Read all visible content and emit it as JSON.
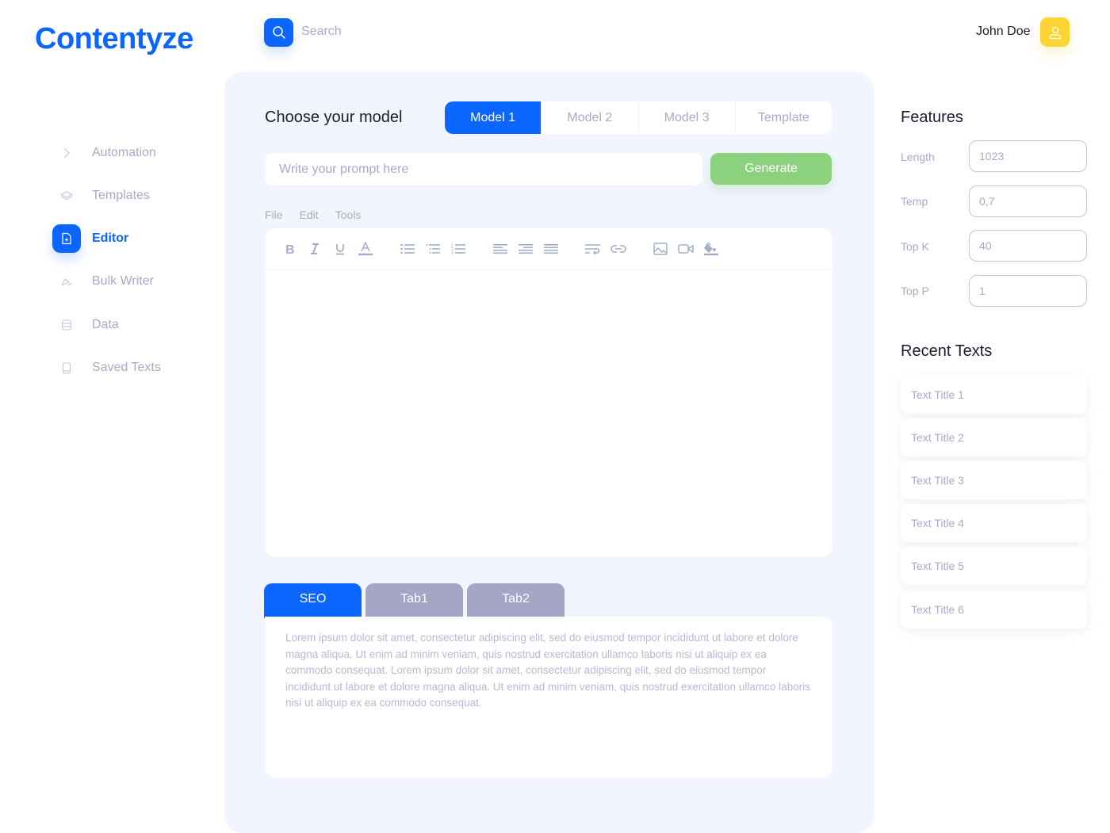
{
  "app": {
    "logo": "Contentyze",
    "brand_color": "#0a66ff"
  },
  "header": {
    "search_label": "Search",
    "user_name": "John Doe"
  },
  "sidebar": {
    "items": [
      {
        "label": "Automation",
        "icon": "chevron-right-icon",
        "active": false
      },
      {
        "label": "Templates",
        "icon": "layers-icon",
        "active": false
      },
      {
        "label": "Editor",
        "icon": "document-icon",
        "active": true
      },
      {
        "label": "Bulk Writer",
        "icon": "pen-icon",
        "active": false
      },
      {
        "label": "Data",
        "icon": "database-icon",
        "active": false
      },
      {
        "label": "Saved Texts",
        "icon": "book-icon",
        "active": false
      }
    ]
  },
  "main": {
    "choose_title": "Choose your model",
    "model_tabs": [
      {
        "label": "Model 1",
        "active": true
      },
      {
        "label": "Model 2",
        "active": false
      },
      {
        "label": "Model 3",
        "active": false
      },
      {
        "label": "Template",
        "active": false
      }
    ],
    "prompt": {
      "placeholder": "Write your prompt here",
      "value": ""
    },
    "generate_label": "Generate",
    "generate_color": "#8cd17e",
    "menu": [
      "File",
      "Edit",
      "Tools"
    ],
    "toolbar": [
      "bold",
      "italic",
      "underline",
      "text-color",
      "bullet-list",
      "indent-list",
      "numbered-list",
      "align-left",
      "align-right",
      "justify",
      "text-wrap",
      "link",
      "image",
      "video",
      "fill-color"
    ],
    "bottom_tabs": [
      {
        "label": "SEO",
        "active": true
      },
      {
        "label": "Tab1",
        "active": false
      },
      {
        "label": "Tab2",
        "active": false
      }
    ],
    "seo_text": "Lorem ipsum dolor sit amet, consectetur adipiscing elit, sed do eiusmod tempor incididunt ut labore et dolore magna aliqua. Ut enim ad minim veniam, quis nostrud exercitation ullamco laboris nisi ut aliquip ex ea commodo consequat. Lorem ipsum dolor sit amet, consectetur adipiscing elit, sed do eiusmod tempor incididunt ut labore et dolore magna aliqua. Ut enim ad minim veniam, quis nostrud exercitation ullamco laboris nisi ut aliquip ex ea commodo consequat."
  },
  "features": {
    "title": "Features",
    "fields": [
      {
        "label": "Length",
        "value": "1023"
      },
      {
        "label": "Temp",
        "value": "0,7"
      },
      {
        "label": "Top K",
        "value": "40"
      },
      {
        "label": "Top P",
        "value": "1"
      }
    ]
  },
  "recent": {
    "title": "Recent Texts",
    "items": [
      "Text Title 1",
      "Text Title 2",
      "Text Title 3",
      "Text Title 4",
      "Text Title 5",
      "Text Title 6"
    ]
  }
}
